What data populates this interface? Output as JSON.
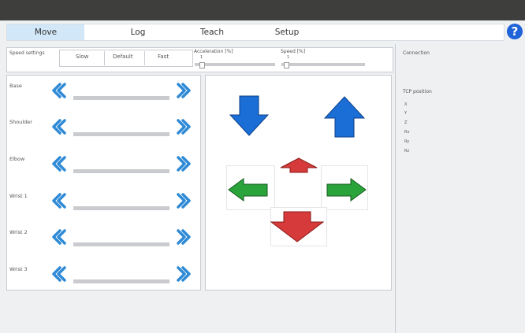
{
  "window": {
    "title_left": "",
    "title_center": "",
    "subtitle_center": "",
    "controls_right": ""
  },
  "tabs": [
    {
      "label": "Move",
      "active": true
    },
    {
      "label": "Log",
      "active": false
    },
    {
      "label": "Teach",
      "active": false
    },
    {
      "label": "Setup",
      "active": false
    }
  ],
  "help": {
    "icon": "help-icon",
    "label": "?"
  },
  "speed": {
    "label": "Speed settings",
    "buttons": [
      "Slow",
      "Default",
      "Fast"
    ],
    "acceleration_label": "Acceleration [%]",
    "acceleration_value": "1",
    "speed_label": "Speed [%]",
    "speed_value": "1"
  },
  "connection": {
    "label": "Connection"
  },
  "tcp": {
    "label": "TCP position",
    "fields": [
      "X",
      "Y",
      "Z",
      "Rx",
      "Ry",
      "Rz"
    ]
  },
  "joints": [
    {
      "label": "Base"
    },
    {
      "label": "Shoulder"
    },
    {
      "label": "Elbow"
    },
    {
      "label": "Wrist 1"
    },
    {
      "label": "Wrist 2"
    },
    {
      "label": "Wrist 3"
    }
  ],
  "jog_arrows": [
    {
      "name": "down",
      "color": "#1a6ed6"
    },
    {
      "name": "up",
      "color": "#1a6ed6"
    },
    {
      "name": "up-small",
      "color": "#d73a3a"
    },
    {
      "name": "left",
      "color": "#2ba33b"
    },
    {
      "name": "right",
      "color": "#2ba33b"
    },
    {
      "name": "down-red",
      "color": "#d73a3a"
    }
  ],
  "colors": {
    "accent": "#2f8ad6",
    "tab_active": "#d2e7f8"
  }
}
